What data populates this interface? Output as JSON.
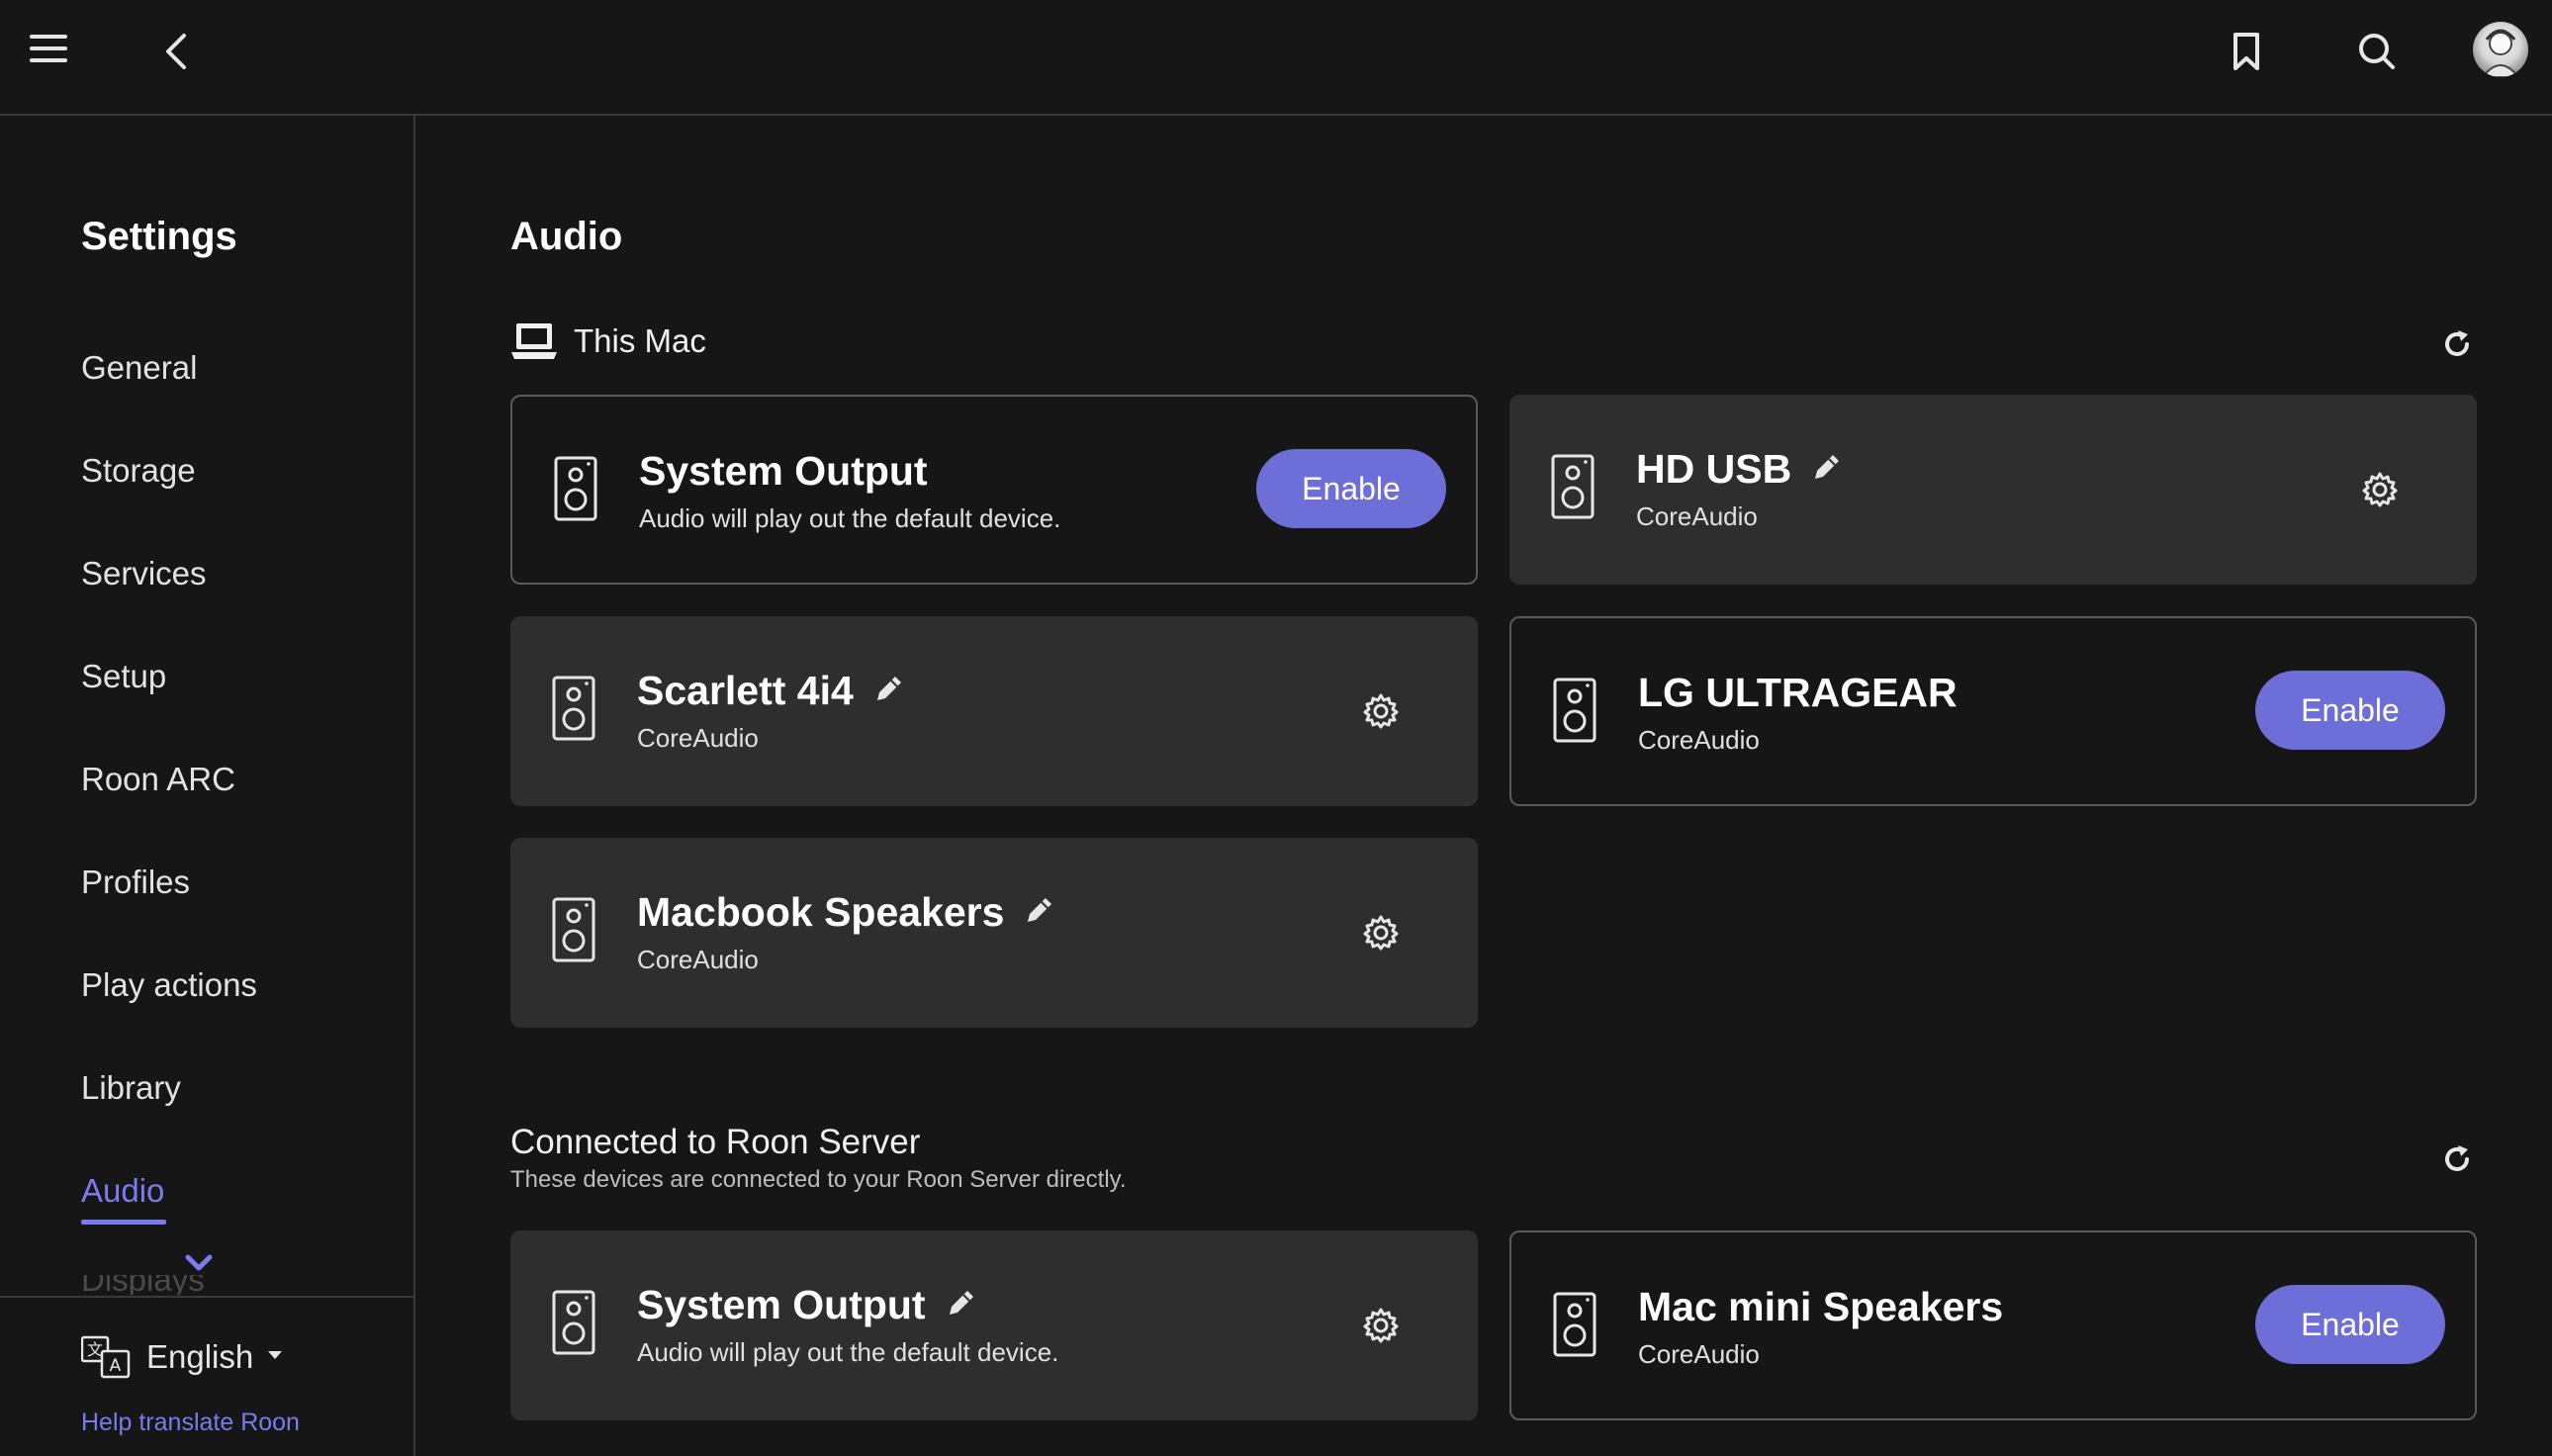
{
  "sidebar": {
    "title": "Settings",
    "items": [
      {
        "label": "General"
      },
      {
        "label": "Storage"
      },
      {
        "label": "Services"
      },
      {
        "label": "Setup"
      },
      {
        "label": "Roon ARC"
      },
      {
        "label": "Profiles"
      },
      {
        "label": "Play actions"
      },
      {
        "label": "Library"
      },
      {
        "label": "Audio"
      },
      {
        "label": "Displays"
      }
    ],
    "active_item": "Audio",
    "language": "English",
    "help_link": "Help translate Roon"
  },
  "main": {
    "title": "Audio",
    "this_mac": {
      "label": "This Mac",
      "devices": [
        {
          "name": "System Output",
          "sub": "Audio will play out the default device.",
          "enable_label": "Enable"
        },
        {
          "name": "HD USB",
          "sub": "CoreAudio"
        },
        {
          "name": "Scarlett 4i4",
          "sub": "CoreAudio"
        },
        {
          "name": "LG ULTRAGEAR",
          "sub": "CoreAudio",
          "enable_label": "Enable"
        },
        {
          "name": "Macbook Speakers",
          "sub": "CoreAudio"
        }
      ]
    },
    "connected": {
      "title": "Connected to Roon Server",
      "subtitle": "These devices are connected to your Roon Server directly.",
      "devices": [
        {
          "name": "System Output",
          "sub": "Audio will play out the default device."
        },
        {
          "name": "Mac mini Speakers",
          "sub": "CoreAudio",
          "enable_label": "Enable"
        }
      ]
    }
  },
  "colors": {
    "accent": "#7b7bf0",
    "button": "#6e6ed8",
    "card": "#2e2e2e",
    "background": "#161616"
  }
}
